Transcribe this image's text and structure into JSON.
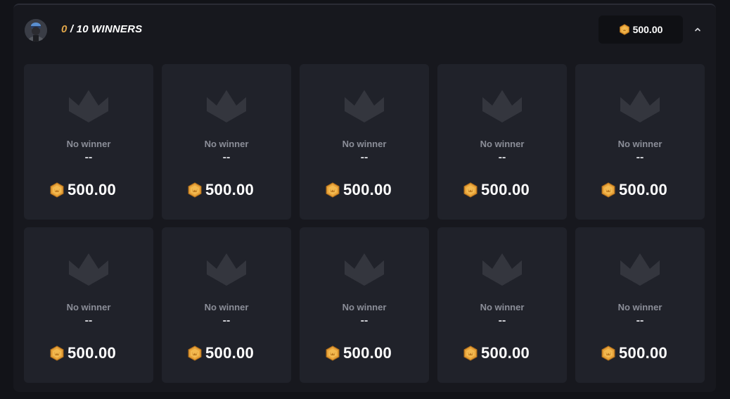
{
  "header": {
    "winners_count": "0",
    "winners_label": " / 10 WINNERS",
    "pool_amount": "500.00",
    "collapse_icon": "chevron-up-icon"
  },
  "colors": {
    "accent": "#e0a64a",
    "coin": "#e8a33a",
    "card_bg": "#20222a",
    "panel_bg": "#17181e"
  },
  "cards": [
    {
      "status": "No winner",
      "winner": "--",
      "amount": "500.00"
    },
    {
      "status": "No winner",
      "winner": "--",
      "amount": "500.00"
    },
    {
      "status": "No winner",
      "winner": "--",
      "amount": "500.00"
    },
    {
      "status": "No winner",
      "winner": "--",
      "amount": "500.00"
    },
    {
      "status": "No winner",
      "winner": "--",
      "amount": "500.00"
    },
    {
      "status": "No winner",
      "winner": "--",
      "amount": "500.00"
    },
    {
      "status": "No winner",
      "winner": "--",
      "amount": "500.00"
    },
    {
      "status": "No winner",
      "winner": "--",
      "amount": "500.00"
    },
    {
      "status": "No winner",
      "winner": "--",
      "amount": "500.00"
    },
    {
      "status": "No winner",
      "winner": "--",
      "amount": "500.00"
    }
  ]
}
